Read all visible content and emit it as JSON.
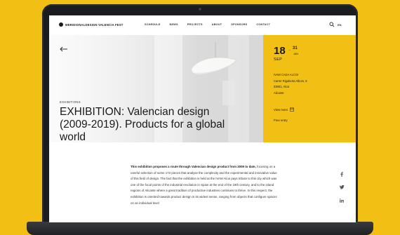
{
  "header": {
    "logo": "MERIDIONALDESIGN VALENCIA FEST",
    "nav": [
      "SCHEDULE",
      "NEWS",
      "PROJECTS",
      "ABOUT",
      "SPONSORS",
      "CONTACT"
    ],
    "lang": "EN"
  },
  "hero": {
    "tag": "EXHIBITIONS",
    "title": "EXHIBITION: Valencian design (2009-2019). Products for a global world"
  },
  "info": {
    "date_start": "18",
    "date_sep": "-",
    "date_end": "31",
    "date_end_month": "JAN",
    "month": "SEP",
    "venue": [
      "IVAM CADA ALCOI",
      "Carrer Rigoberta Albors, 8",
      "03801, Alcoi",
      "Alicante"
    ],
    "view_more": "View more",
    "entry": "Free entry"
  },
  "article": {
    "lead": "This exhibition proposes a route through Valencian design product from 2009 to date,",
    "body": " focusing on a careful selection of some 172 pieces that analyse the complexity and the experimental and innovative value of this field of design. The fact that the exhibition is held at the IVAM Alcoi pays tribute to this city which was one of the focal points of the industrial revolution in Spain at the end of the 19th century, and to the inland regions of Alicante where a great tradition of productive industries continues to thrive. In this respect, the exhibition is oriented towards product design in its widest sense, ranging from objects that configure spaces on an individual level"
  },
  "icons": {
    "search": "search-icon",
    "back": "arrow-left-icon",
    "calendar": "calendar-icon",
    "share": [
      "facebook-icon",
      "twitter-icon",
      "linkedin-icon"
    ]
  },
  "colors": {
    "accent": "#f2c014",
    "text": "#1a1a1a",
    "laptop": "#1b1c1f"
  }
}
